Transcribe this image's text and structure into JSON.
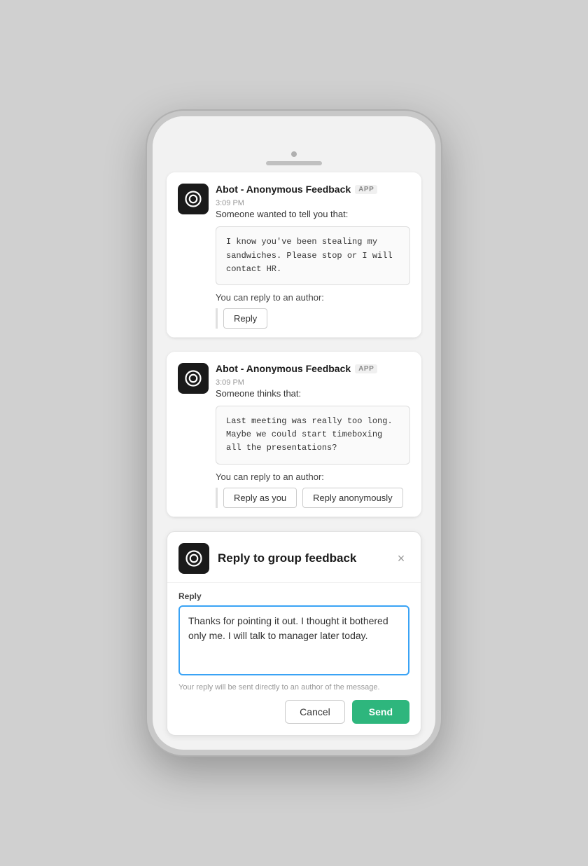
{
  "phone": {
    "message1": {
      "bot_name": "Abot - Anonymous Feedback",
      "app_badge": "APP",
      "time": "3:09 PM",
      "subtitle": "Someone wanted to tell you that:",
      "content": "I know you've been stealing my sandwiches.\nPlease stop or I will contact HR.",
      "reply_prompt": "You can reply to an author:",
      "reply_button": "Reply"
    },
    "message2": {
      "bot_name": "Abot - Anonymous Feedback",
      "app_badge": "APP",
      "time": "3:09 PM",
      "subtitle": "Someone thinks that:",
      "content": "Last meeting was really too long. Maybe we\ncould start timeboxing all the presentations?",
      "reply_prompt": "You can reply to an author:",
      "reply_as_you": "Reply as you",
      "reply_anon": "Reply anonymously"
    },
    "modal": {
      "title": "Reply to group feedback",
      "field_label": "Reply",
      "textarea_value": "Thanks for pointing it out. I thought it bothered only me. I will talk to manager later today.",
      "hint": "Your reply will be sent directly to an author of the message.",
      "cancel_label": "Cancel",
      "send_label": "Send"
    }
  }
}
